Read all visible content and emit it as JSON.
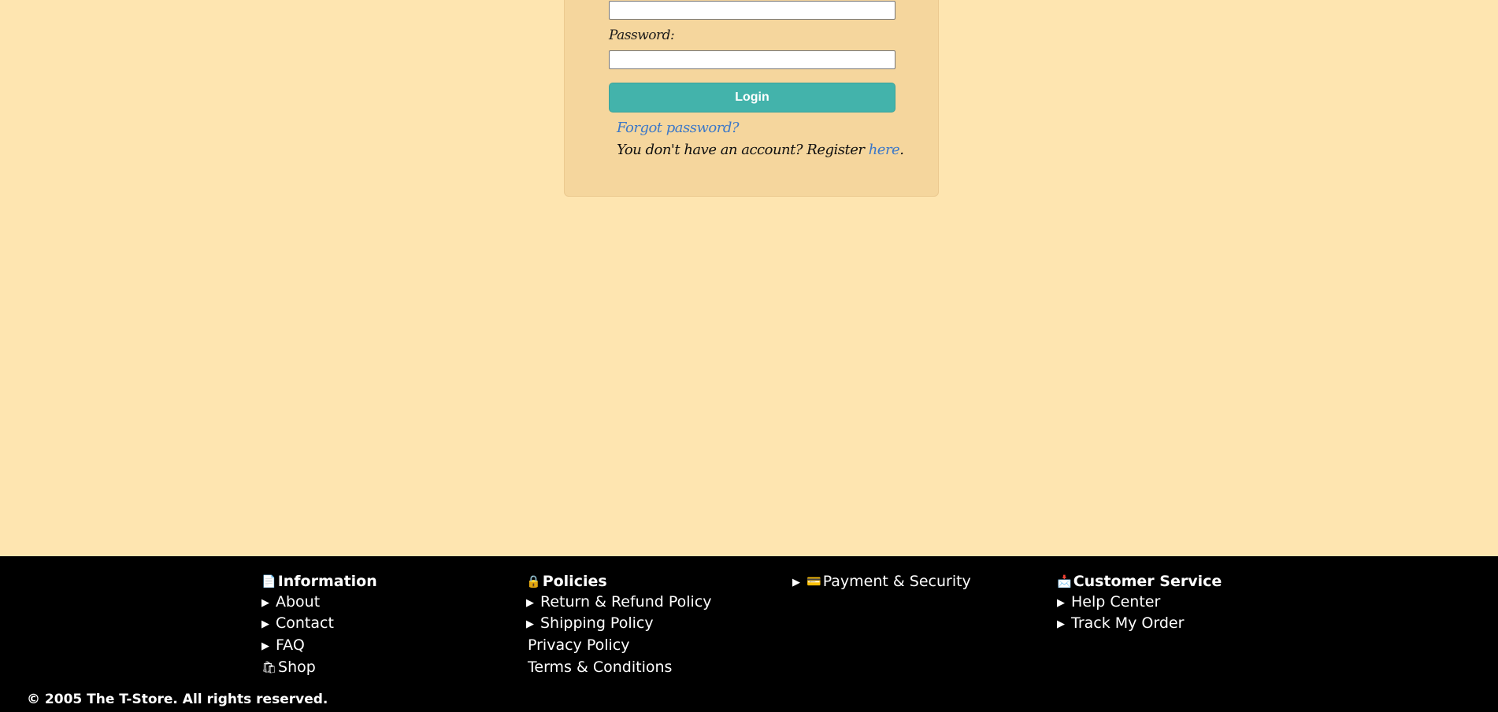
{
  "login": {
    "username_value": "",
    "password_label": "Password:",
    "password_value": "",
    "login_button": "Login",
    "forgot_password": "Forgot password?",
    "register_prefix": "You don't have an account? Register ",
    "register_link": "here",
    "register_suffix": "."
  },
  "footer": {
    "information": {
      "icon": "📄",
      "title": "Information",
      "items": [
        "About",
        "Contact",
        "FAQ"
      ],
      "shop_icon": "🛍",
      "shop": "Shop"
    },
    "policies": {
      "icon": "🔒",
      "title": "Policies",
      "items": [
        "Return & Refund Policy",
        "Shipping Policy"
      ],
      "plain_items": [
        "Privacy Policy",
        "Terms & Conditions"
      ]
    },
    "payment": {
      "icon": "💳",
      "title": "Payment & Security"
    },
    "service": {
      "icon": "📩",
      "title": "Customer Service",
      "items": [
        "Help Center",
        "Track My Order"
      ]
    },
    "copyright": "© 2005 The T-Store. All rights reserved."
  }
}
